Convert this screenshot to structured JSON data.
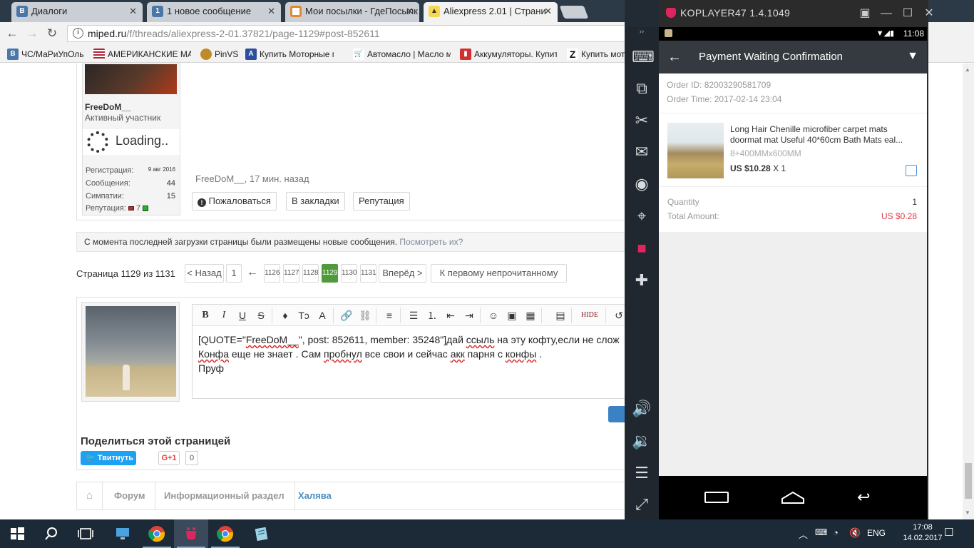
{
  "browser": {
    "tabs": [
      {
        "label": "Диалоги",
        "icon": "vk-icon",
        "color": "#4a76a8",
        "active": false
      },
      {
        "label": "1 новое сообщение",
        "icon": "vk-icon",
        "color": "#4a76a8",
        "active": false
      },
      {
        "label": "Мои посылки - ГдеПосылк",
        "icon": "package-tracker-icon",
        "color": "#e08a2e",
        "active": false
      },
      {
        "label": "Aliexpress 2.01 | Страни",
        "icon": "miped-icon",
        "color": "#333333",
        "active": true
      }
    ],
    "url_host": "miped.ru",
    "url_path": "/f/threads/aliexpress-2-01.37821/page-1129#post-852611",
    "bookmarks": [
      {
        "label": "ЧС/МаРиУпОль",
        "icon": "vk-icon",
        "color": "#4a76a8"
      },
      {
        "label": "АМЕРИКАНСКИЕ МА",
        "icon": "us-flag-icon",
        "color": "#b22234"
      },
      {
        "label": "PinVS",
        "icon": "pin-icon",
        "color": "#c08a2a"
      },
      {
        "label": "Купить Моторные ма",
        "icon": "letter-a-icon",
        "color": "#2d4e9c"
      },
      {
        "label": "Автомасло | Масло м",
        "icon": "cart-icon",
        "color": "#888888"
      },
      {
        "label": "Аккумуляторы. Купит",
        "icon": "battery-icon",
        "color": "#d23030"
      },
      {
        "label": "Купить мот",
        "icon": "letter-z-icon",
        "color": "#111111"
      }
    ]
  },
  "forum": {
    "user": {
      "name": "FreeDoM__",
      "title": "Активный участник",
      "loading_text": "Loading..",
      "stats": [
        {
          "label": "Регистрация:",
          "value": "9 авг 2016"
        },
        {
          "label": "Сообщения:",
          "value": "44"
        },
        {
          "label": "Симпатии:",
          "value": "15"
        }
      ],
      "reputation_label": "Репутация:",
      "reputation_value": "7"
    },
    "post_meta": "FreeDoM__, 17 мин. назад",
    "post_buttons": {
      "report": "Пожаловаться",
      "bookmark": "В закладки",
      "reputation": "Репутация"
    },
    "notice": {
      "text": "С момента последней загрузки страницы были размещены новые сообщения.",
      "link": "Посмотреть их?"
    },
    "pagination": {
      "label": "Страница 1129 из 1131",
      "prev": "< Назад",
      "first": "1",
      "arrow": "←",
      "pages": [
        "1126",
        "1127",
        "1128",
        "1129",
        "1130",
        "1131"
      ],
      "current": "1129",
      "next": "Вперёд >",
      "unread": "К первому непрочитанному"
    },
    "editor": {
      "hide_label": "HIDE",
      "line1_prefix": "[QUOTE=\"",
      "line1_name": "FreeDoM__",
      "line1_mid": "\", post: 852611, member: 35248\"]дай ",
      "line1_word": "ссыль",
      "line1_suffix": " на эту кофту,если не слож",
      "line2_a": "Конфа",
      "line2_b": " еще не знает . Сам ",
      "line2_c": "пробнул",
      "line2_d": " все свои и сейчас ",
      "line2_e": "акк",
      "line2_f": " парня с ",
      "line2_g": "конфы",
      "line2_h": " .",
      "line3": "Пруф"
    },
    "share": {
      "title": "Поделиться этой страницей",
      "tweet": "Твитнуть",
      "gplus": "G+1",
      "gplus_count": "0"
    },
    "breadcrumbs": [
      "Форум",
      "Информационный раздел",
      "Халява"
    ]
  },
  "koplayer": {
    "title": "KOPLAYER47 1.4.1049",
    "status_time": "11:08",
    "appbar_title": "Payment Waiting Confirmation",
    "order_id_label": "Order ID:",
    "order_id": "82003290581709",
    "order_time_label": "Order Time:",
    "order_time": "2017-02-14 23:04",
    "product_title": "Long Hair Chenille microfiber carpet mats doormat mat Useful 40*60cm Bath Mats eal...",
    "product_sku": "8+400MMx600MM",
    "product_price": "US $10.28",
    "product_qty": "X 1",
    "quantity_label": "Quantity",
    "quantity_value": "1",
    "total_label": "Total Amount:",
    "total_value": "US $0.28",
    "total_color": "#e3414f"
  },
  "taskbar": {
    "language": "ENG",
    "time": "17:08",
    "date": "14.02.2017"
  }
}
